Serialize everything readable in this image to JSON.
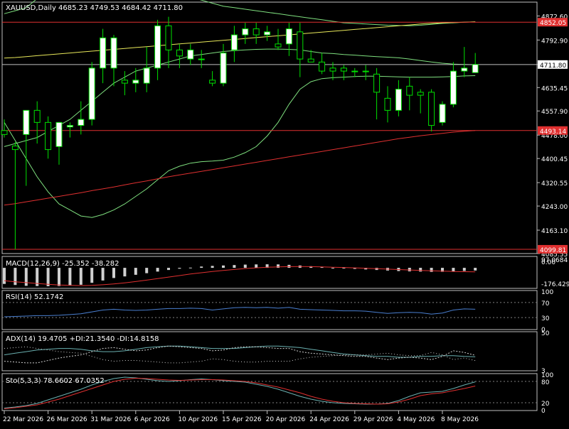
{
  "chart_data": {
    "type": "candlestick",
    "symbol_header": "XAUUSD,Daily  4685.23 4749.53 4684.42 4711.80",
    "ohlc_last": {
      "open": 4685.23,
      "high": 4749.53,
      "low": 4684.42,
      "close": 4711.8
    },
    "price_axis": {
      "ylim": [
        4085.55,
        4918.45
      ],
      "ticks": [
        "4872.60",
        "4792.90",
        "4711.80",
        "4635.45",
        "4557.90",
        "4478.00",
        "4400.45",
        "4320.55",
        "4243.00",
        "4163.10",
        "4085.55"
      ]
    },
    "hlines": [
      {
        "value": 4852.05,
        "label": "4852.05",
        "color": "#e03030"
      },
      {
        "value": 4493.14,
        "label": "4493.14",
        "color": "#e03030"
      },
      {
        "value": 4099.81,
        "label": "4099.81",
        "color": "#e03030"
      }
    ],
    "current_price": {
      "value": 4711.8,
      "label": "4711.80"
    },
    "candles": [
      [
        4493,
        4530,
        4470,
        4480
      ],
      [
        4442,
        4455,
        4100,
        4430
      ],
      [
        4480,
        4560,
        4310,
        4560
      ],
      [
        4560,
        4590,
        4450,
        4520
      ],
      [
        4520,
        4540,
        4400,
        4430
      ],
      [
        4440,
        4520,
        4380,
        4520
      ],
      [
        4505,
        4520,
        4470,
        4510
      ],
      [
        4510,
        4590,
        4480,
        4530
      ],
      [
        4530,
        4720,
        4510,
        4700
      ],
      [
        4700,
        4830,
        4650,
        4800
      ],
      [
        4700,
        4810,
        4640,
        4800
      ],
      [
        4660,
        4690,
        4610,
        4650
      ],
      [
        4650,
        4700,
        4620,
        4660
      ],
      [
        4650,
        4770,
        4620,
        4700
      ],
      [
        4700,
        4860,
        4660,
        4840
      ],
      [
        4840,
        4870,
        4700,
        4760
      ],
      [
        4760,
        4780,
        4700,
        4740
      ],
      [
        4730,
        4780,
        4710,
        4760
      ],
      [
        4730,
        4760,
        4700,
        4730
      ],
      [
        4660,
        4690,
        4640,
        4650
      ],
      [
        4650,
        4780,
        4640,
        4750
      ],
      [
        4760,
        4840,
        4720,
        4810
      ],
      [
        4810,
        4850,
        4780,
        4830
      ],
      [
        4830,
        4850,
        4780,
        4810
      ],
      [
        4810,
        4840,
        4790,
        4820
      ],
      [
        4780,
        4830,
        4760,
        4770
      ],
      [
        4780,
        4850,
        4740,
        4830
      ],
      [
        4820,
        4850,
        4670,
        4730
      ],
      [
        4730,
        4760,
        4720,
        4720
      ],
      [
        4720,
        4750,
        4680,
        4690
      ],
      [
        4700,
        4720,
        4660,
        4690
      ],
      [
        4700,
        4710,
        4660,
        4690
      ],
      [
        4690,
        4700,
        4670,
        4690
      ],
      [
        4690,
        4710,
        4660,
        4690
      ],
      [
        4680,
        4700,
        4530,
        4620
      ],
      [
        4600,
        4640,
        4520,
        4560
      ],
      [
        4560,
        4660,
        4540,
        4630
      ],
      [
        4640,
        4670,
        4560,
        4610
      ],
      [
        4620,
        4630,
        4550,
        4610
      ],
      [
        4620,
        4630,
        4490,
        4510
      ],
      [
        4520,
        4590,
        4510,
        4580
      ],
      [
        4580,
        4720,
        4570,
        4690
      ],
      [
        4690,
        4770,
        4670,
        4700
      ],
      [
        4685,
        4750,
        4684,
        4712
      ]
    ],
    "overlays": [
      {
        "name": "upper-band",
        "color": "#7fe07f",
        "values": [
          4880,
          4890,
          4900,
          4930,
          4960,
          5000,
          5020,
          5040,
          5050,
          5060,
          5060,
          5050,
          5030,
          5000,
          4980,
          4960,
          4945,
          4935,
          4925,
          4915,
          4905,
          4900,
          4895,
          4890,
          4885,
          4880,
          4875,
          4870,
          4865,
          4860,
          4855,
          4850,
          4848,
          4846,
          4844,
          4842,
          4841,
          4840,
          4842,
          4845,
          4848,
          4850,
          4852,
          4853
        ]
      },
      {
        "name": "middle-band",
        "color": "#7fe07f",
        "values": [
          4440,
          4450,
          4460,
          4470,
          4490,
          4510,
          4530,
          4560,
          4590,
          4620,
          4650,
          4670,
          4690,
          4700,
          4710,
          4720,
          4730,
          4740,
          4745,
          4750,
          4755,
          4758,
          4760,
          4762,
          4763,
          4763,
          4762,
          4760,
          4755,
          4750,
          4748,
          4745,
          4743,
          4740,
          4738,
          4736,
          4734,
          4730,
          4725,
          4720,
          4716,
          4713,
          4712,
          4711
        ]
      },
      {
        "name": "lower-band",
        "color": "#7fe07f",
        "values": [
          4520,
          4460,
          4400,
          4340,
          4290,
          4250,
          4230,
          4210,
          4205,
          4215,
          4230,
          4250,
          4275,
          4300,
          4330,
          4360,
          4375,
          4385,
          4390,
          4392,
          4395,
          4405,
          4420,
          4440,
          4475,
          4520,
          4580,
          4630,
          4655,
          4665,
          4668,
          4670,
          4672,
          4673,
          4673,
          4672,
          4671,
          4670,
          4670,
          4670,
          4671,
          4672,
          4674,
          4675
        ]
      },
      {
        "name": "slow-ma-yellow",
        "color": "#e8e85a",
        "values": [
          4733,
          4735,
          4738,
          4741,
          4744,
          4747,
          4750,
          4753,
          4756,
          4759,
          4762,
          4765,
          4768,
          4771,
          4774,
          4777,
          4780,
          4783,
          4786,
          4789,
          4792,
          4795,
          4798,
          4801,
          4804,
          4807,
          4810,
          4813,
          4816,
          4819,
          4822,
          4825,
          4828,
          4831,
          4834,
          4837,
          4840,
          4843,
          4846,
          4848,
          4850,
          4851,
          4852,
          4853
        ]
      },
      {
        "name": "slow-ma-red",
        "color": "#e03030",
        "values": [
          4246,
          4251,
          4257,
          4263,
          4269,
          4275,
          4281,
          4287,
          4294,
          4300,
          4306,
          4313,
          4320,
          4326,
          4333,
          4340,
          4346,
          4352,
          4358,
          4364,
          4370,
          4376,
          4382,
          4388,
          4394,
          4400,
          4406,
          4412,
          4418,
          4424,
          4430,
          4436,
          4442,
          4448,
          4454,
          4460,
          4466,
          4471,
          4476,
          4480,
          4484,
          4488,
          4491,
          4493
        ]
      }
    ],
    "macd": {
      "label": "MACD(12,26,9) -25.352 -38.282",
      "ticks": [
        "97.0684",
        "0.00",
        "-176.429"
      ],
      "ylim": [
        -185,
        100
      ],
      "hist": [
        -150,
        -160,
        -168,
        -170,
        -172,
        -170,
        -165,
        -158,
        -140,
        -118,
        -95,
        -80,
        -65,
        -50,
        -35,
        -20,
        -8,
        2,
        12,
        18,
        22,
        26,
        30,
        32,
        33,
        32,
        28,
        22,
        15,
        8,
        0,
        -5,
        -10,
        -15,
        -20,
        -25,
        -30,
        -33,
        -35,
        -38,
        -37,
        -33,
        -29,
        -25
      ],
      "signal": [
        -120,
        -130,
        -138,
        -146,
        -154,
        -160,
        -164,
        -166,
        -164,
        -158,
        -150,
        -140,
        -128,
        -115,
        -100,
        -86,
        -72,
        -58,
        -46,
        -34,
        -24,
        -15,
        -7,
        0,
        5,
        9,
        11,
        12,
        11,
        9,
        6,
        3,
        0,
        -4,
        -8,
        -12,
        -16,
        -20,
        -24,
        -28,
        -31,
        -34,
        -36,
        -38
      ]
    },
    "rsi": {
      "label": "RSI(14) 52.1742",
      "ticks": [
        "100",
        "70",
        "30",
        "0"
      ],
      "ylim": [
        0,
        100
      ],
      "values": [
        32,
        33,
        34,
        35,
        35,
        36,
        38,
        40,
        45,
        50,
        52,
        50,
        49,
        50,
        52,
        54,
        54,
        55,
        54,
        50,
        53,
        56,
        57,
        56,
        57,
        55,
        57,
        52,
        51,
        50,
        49,
        48,
        48,
        47,
        44,
        41,
        43,
        44,
        43,
        39,
        42,
        50,
        53,
        52
      ]
    },
    "adx": {
      "label": "ADX(14) 19.4705 +DI:21.3540 -DI:14.8158",
      "ticks": [
        "50",
        "3"
      ],
      "ylim": [
        3,
        50
      ],
      "adx": [
        22,
        24,
        26,
        28,
        29,
        30,
        30,
        29,
        27,
        26,
        26,
        27,
        29,
        31,
        32,
        33,
        33,
        32,
        31,
        30,
        30,
        30,
        31,
        32,
        33,
        33,
        32,
        31,
        29,
        27,
        25,
        23,
        22,
        21,
        20,
        20,
        19,
        19,
        20,
        20,
        21,
        21,
        20,
        19.5
      ],
      "plus_di": [
        14,
        13,
        12,
        12,
        15,
        18,
        20,
        22,
        26,
        30,
        31,
        29,
        27,
        28,
        31,
        33,
        32,
        31,
        30,
        27,
        28,
        31,
        32,
        32,
        31,
        30,
        30,
        26,
        24,
        23,
        22,
        21,
        20,
        20,
        18,
        16,
        18,
        19,
        18,
        16,
        20,
        27,
        25,
        21.4
      ],
      "minus_di": [
        30,
        31,
        32,
        30,
        28,
        26,
        25,
        24,
        20,
        16,
        14,
        15,
        15,
        14,
        13,
        12,
        12,
        13,
        14,
        17,
        16,
        14,
        13,
        13,
        14,
        14,
        14,
        17,
        19,
        20,
        21,
        22,
        22,
        22,
        23,
        24,
        22,
        21,
        21,
        25,
        22,
        16,
        18,
        14.8
      ]
    },
    "stoch": {
      "label": "Sto(5,3,3) 78.6602 67.0352",
      "ticks": [
        "100",
        "80",
        "20",
        "0"
      ],
      "ylim": [
        0,
        100
      ],
      "main": [
        5,
        8,
        12,
        18,
        28,
        38,
        48,
        58,
        70,
        80,
        88,
        92,
        90,
        86,
        82,
        80,
        82,
        85,
        87,
        85,
        82,
        80,
        78,
        72,
        66,
        58,
        48,
        38,
        30,
        24,
        20,
        18,
        17,
        16,
        16,
        18,
        26,
        38,
        48,
        50,
        52,
        60,
        70,
        78.7
      ],
      "signal": [
        3,
        6,
        10,
        14,
        22,
        30,
        40,
        50,
        60,
        70,
        80,
        86,
        89,
        88,
        86,
        84,
        83,
        84,
        85,
        85,
        84,
        82,
        80,
        76,
        70,
        64,
        56,
        48,
        38,
        30,
        24,
        20,
        18,
        17,
        16,
        17,
        22,
        30,
        40,
        45,
        48,
        54,
        60,
        67
      ]
    },
    "x_ticks": [
      {
        "i": 0,
        "label": "22 Mar 2026"
      },
      {
        "i": 4,
        "label": "26 Mar 2026"
      },
      {
        "i": 8,
        "label": "31 Mar 2026"
      },
      {
        "i": 12,
        "label": "6 Apr 2026"
      },
      {
        "i": 16,
        "label": "10 Apr 2026"
      },
      {
        "i": 20,
        "label": "15 Apr 2026"
      },
      {
        "i": 24,
        "label": "20 Apr 2026"
      },
      {
        "i": 28,
        "label": "24 Apr 2026"
      },
      {
        "i": 32,
        "label": "29 Apr 2026"
      },
      {
        "i": 36,
        "label": "4 May 2026"
      },
      {
        "i": 40,
        "label": "8 May 2026"
      }
    ],
    "colors": {
      "background": "#000000",
      "grid": "#c0c0c0",
      "text": "#ffffff",
      "bull": "#ffffff",
      "bear": "#000000",
      "candle_outline": "#00e000",
      "rsi": "#4a7fd0",
      "adx": "#6ab0b0",
      "plus_di": "#d0d0d0",
      "minus_di": "#d0d0d0",
      "stoch_main": "#6ab0b0",
      "stoch_signal": "#e03030",
      "macd_hist": "#d0d0d0",
      "macd_signal": "#e03030"
    }
  }
}
